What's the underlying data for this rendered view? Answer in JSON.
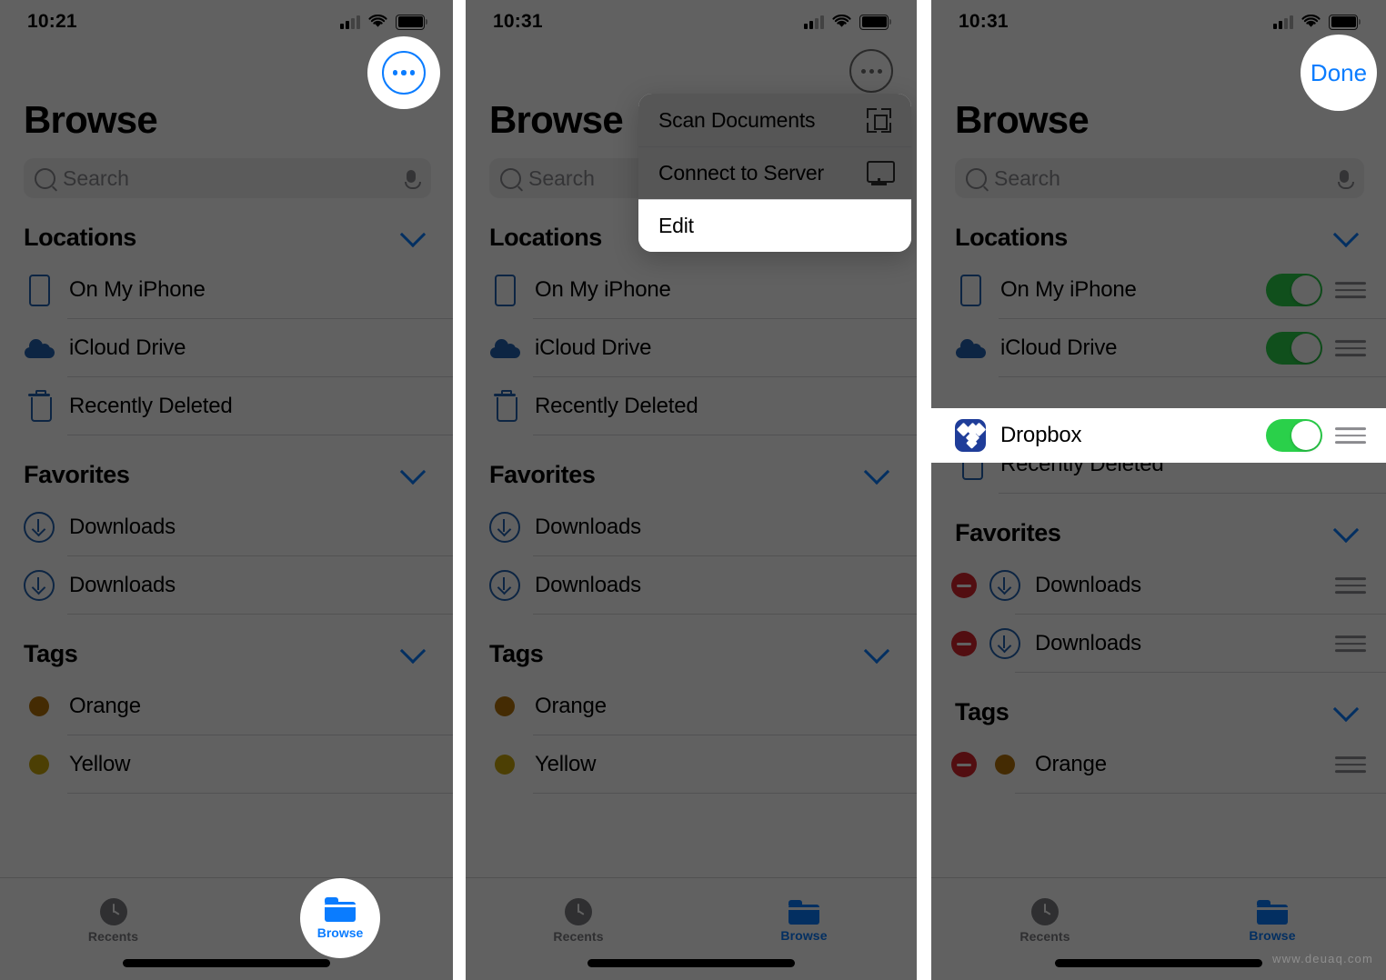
{
  "meta": {
    "watermark": "www.deuaq.com"
  },
  "panels": [
    {
      "status": {
        "time": "10:21"
      },
      "title": "Browse",
      "search": {
        "placeholder": "Search",
        "value": ""
      },
      "sections": [
        {
          "header": "Locations",
          "rows": [
            {
              "label": "On My iPhone",
              "icon": "iphone-icon"
            },
            {
              "label": "iCloud Drive",
              "icon": "cloud-icon"
            },
            {
              "label": "Recently Deleted",
              "icon": "trash-icon"
            }
          ]
        },
        {
          "header": "Favorites",
          "rows": [
            {
              "label": "Downloads",
              "icon": "download-icon"
            },
            {
              "label": "Downloads",
              "icon": "download-icon"
            }
          ]
        },
        {
          "header": "Tags",
          "rows": [
            {
              "label": "Orange",
              "icon": "tag-dot-icon",
              "color": "#b3720a"
            },
            {
              "label": "Yellow",
              "icon": "tag-dot-icon",
              "color": "#c9a70c"
            }
          ]
        }
      ],
      "tabs": [
        {
          "label": "Recents",
          "icon": "clock-icon",
          "active": false
        },
        {
          "label": "Browse",
          "icon": "folder-icon",
          "active": true
        }
      ],
      "more_button": {
        "icon": "ellipsis-circle-icon"
      }
    },
    {
      "status": {
        "time": "10:31"
      },
      "title": "Browse",
      "search": {
        "placeholder": "Search",
        "value": ""
      },
      "menu": [
        {
          "label": "Scan Documents",
          "icon": "scan-documents-icon",
          "highlighted": false
        },
        {
          "label": "Connect to Server",
          "icon": "server-display-icon",
          "highlighted": false
        },
        {
          "label": "Edit",
          "icon": "",
          "highlighted": true
        }
      ],
      "sections": [
        {
          "header": "Locations",
          "rows": [
            {
              "label": "On My iPhone",
              "icon": "iphone-icon"
            },
            {
              "label": "iCloud Drive",
              "icon": "cloud-icon"
            },
            {
              "label": "Recently Deleted",
              "icon": "trash-icon"
            }
          ]
        },
        {
          "header": "Favorites",
          "rows": [
            {
              "label": "Downloads",
              "icon": "download-icon"
            },
            {
              "label": "Downloads",
              "icon": "download-icon"
            }
          ]
        },
        {
          "header": "Tags",
          "rows": [
            {
              "label": "Orange",
              "icon": "tag-dot-icon",
              "color": "#b3720a"
            },
            {
              "label": "Yellow",
              "icon": "tag-dot-icon",
              "color": "#c9a70c"
            }
          ]
        }
      ],
      "tabs": [
        {
          "label": "Recents",
          "icon": "clock-icon",
          "active": false
        },
        {
          "label": "Browse",
          "icon": "folder-icon",
          "active": true
        }
      ],
      "more_button": {
        "icon": "ellipsis-circle-icon"
      }
    },
    {
      "status": {
        "time": "10:31"
      },
      "title": "Browse",
      "done_label": "Done",
      "search": {
        "placeholder": "Search",
        "value": ""
      },
      "sections": [
        {
          "header": "Locations",
          "rows": [
            {
              "label": "On My iPhone",
              "icon": "iphone-icon",
              "toggle": "on",
              "grip": true
            },
            {
              "label": "iCloud Drive",
              "icon": "cloud-icon",
              "toggle": "on",
              "grip": true
            },
            {
              "label": "Dropbox",
              "icon": "dropbox-icon",
              "toggle": "on",
              "grip": true,
              "highlighted": true
            },
            {
              "label": "Recently Deleted",
              "icon": "trash-icon",
              "toggle": "none",
              "grip": false
            }
          ]
        },
        {
          "header": "Favorites",
          "rows": [
            {
              "label": "Downloads",
              "icon": "download-icon",
              "remove": true,
              "grip": true
            },
            {
              "label": "Downloads",
              "icon": "download-icon",
              "remove": true,
              "grip": true
            }
          ]
        },
        {
          "header": "Tags",
          "rows": [
            {
              "label": "Orange",
              "icon": "tag-dot-icon",
              "color": "#b3720a",
              "remove": true,
              "grip": true
            }
          ]
        }
      ],
      "tabs": [
        {
          "label": "Recents",
          "icon": "clock-icon",
          "active": false
        },
        {
          "label": "Browse",
          "icon": "folder-icon",
          "active": true
        }
      ]
    }
  ],
  "colors": {
    "accent": "#0a7cff",
    "toggle_on": "#2ad04a",
    "remove_red": "#d7262e",
    "icon_blue": "#2463b0"
  }
}
